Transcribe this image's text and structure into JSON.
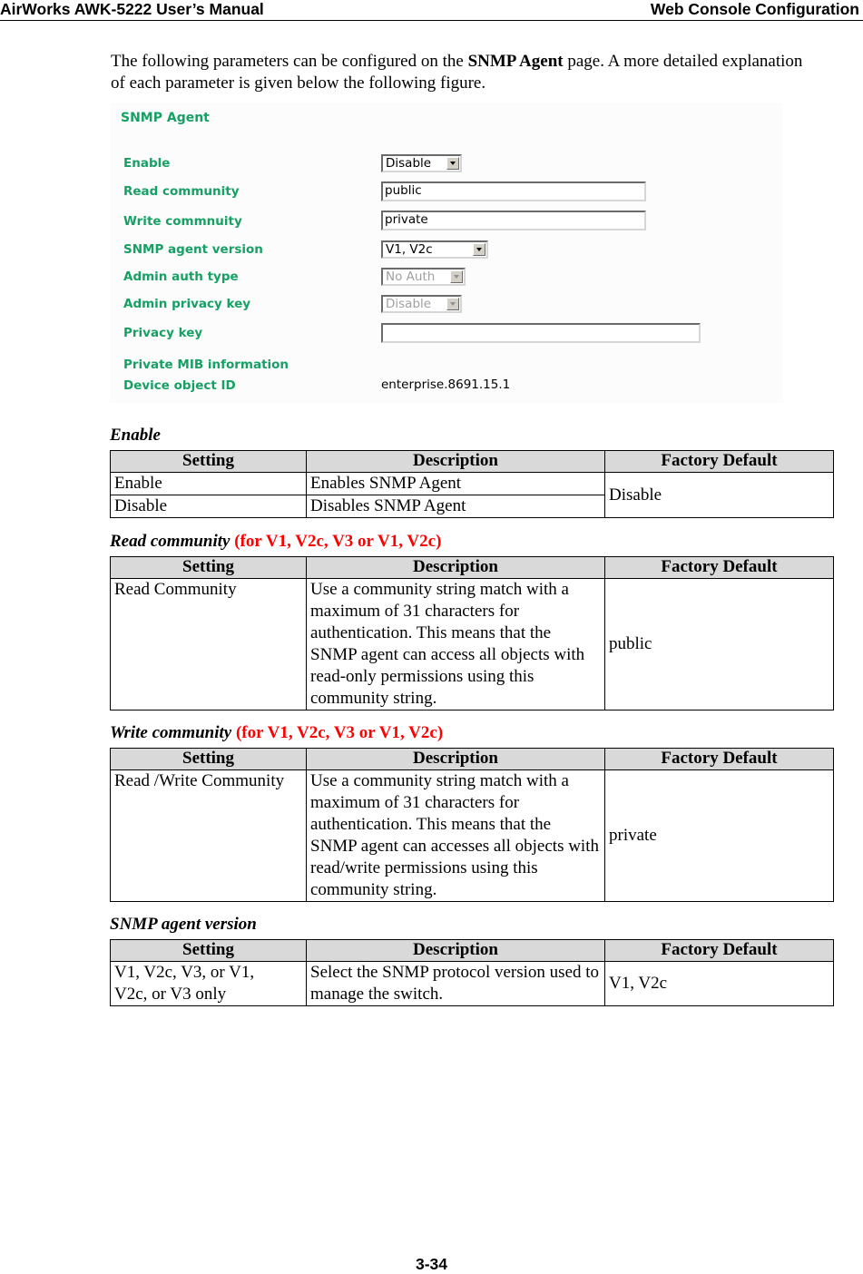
{
  "header": {
    "left": "AirWorks AWK-5222 User’s Manual",
    "right": "Web Console Configuration"
  },
  "intro": {
    "before": "The following parameters can be configured on the ",
    "bold": "SNMP Agent",
    "after": " page. A more detailed explanation of each parameter is given below the following figure."
  },
  "figure": {
    "title": "SNMP Agent",
    "fields": [
      {
        "label": "Enable",
        "type": "select",
        "value": "Disable",
        "disabled": false
      },
      {
        "label": "Read community",
        "type": "text",
        "value": "public"
      },
      {
        "label": "Write commnuity",
        "type": "text",
        "value": "private"
      },
      {
        "label": "SNMP agent version",
        "type": "select",
        "value": "V1, V2c",
        "disabled": false
      },
      {
        "label": "Admin auth type",
        "type": "select",
        "value": "No Auth",
        "disabled": true
      },
      {
        "label": "Admin privacy key",
        "type": "select",
        "value": "Disable",
        "disabled": true
      },
      {
        "label": "Privacy key",
        "type": "text",
        "value": ""
      },
      {
        "label": "Private MIB information"
      },
      {
        "label": "Device object ID",
        "type": "static",
        "value": "enterprise.8691.15.1"
      }
    ]
  },
  "columns": {
    "setting": "Setting",
    "description": "Description",
    "default": "Factory Default"
  },
  "sections": [
    {
      "title": "Enable",
      "qualifier": "",
      "rows": [
        {
          "setting": "Enable",
          "description": "Enables SNMP Agent"
        },
        {
          "setting": "Disable",
          "description": "Disables SNMP Agent"
        }
      ],
      "default": "Disable"
    },
    {
      "title": "Read community",
      "qualifier": "(for V1, V2c, V3 or V1, V2c)",
      "rows": [
        {
          "setting": "Read Community",
          "description": "Use a community string match with a maximum of 31 characters for authentication. This means that the SNMP agent can access all objects with read-only permissions using this community string."
        }
      ],
      "default": "public"
    },
    {
      "title": "Write community",
      "qualifier": "(for V1, V2c, V3 or V1, V2c)",
      "rows": [
        {
          "setting": "Read /Write Community",
          "description": "Use a community string match with a maximum of 31 characters for authentication. This means that the SNMP agent can accesses all objects with read/write permissions using this community string."
        }
      ],
      "default": "private"
    },
    {
      "title": "SNMP agent version",
      "qualifier": "",
      "rows": [
        {
          "setting": "V1, V2c, V3, or V1, V2c, or V3 only",
          "description": "Select the SNMP protocol version used to manage the switch."
        }
      ],
      "default": "V1, V2c"
    }
  ],
  "footer": {
    "page_number": "3-34"
  }
}
